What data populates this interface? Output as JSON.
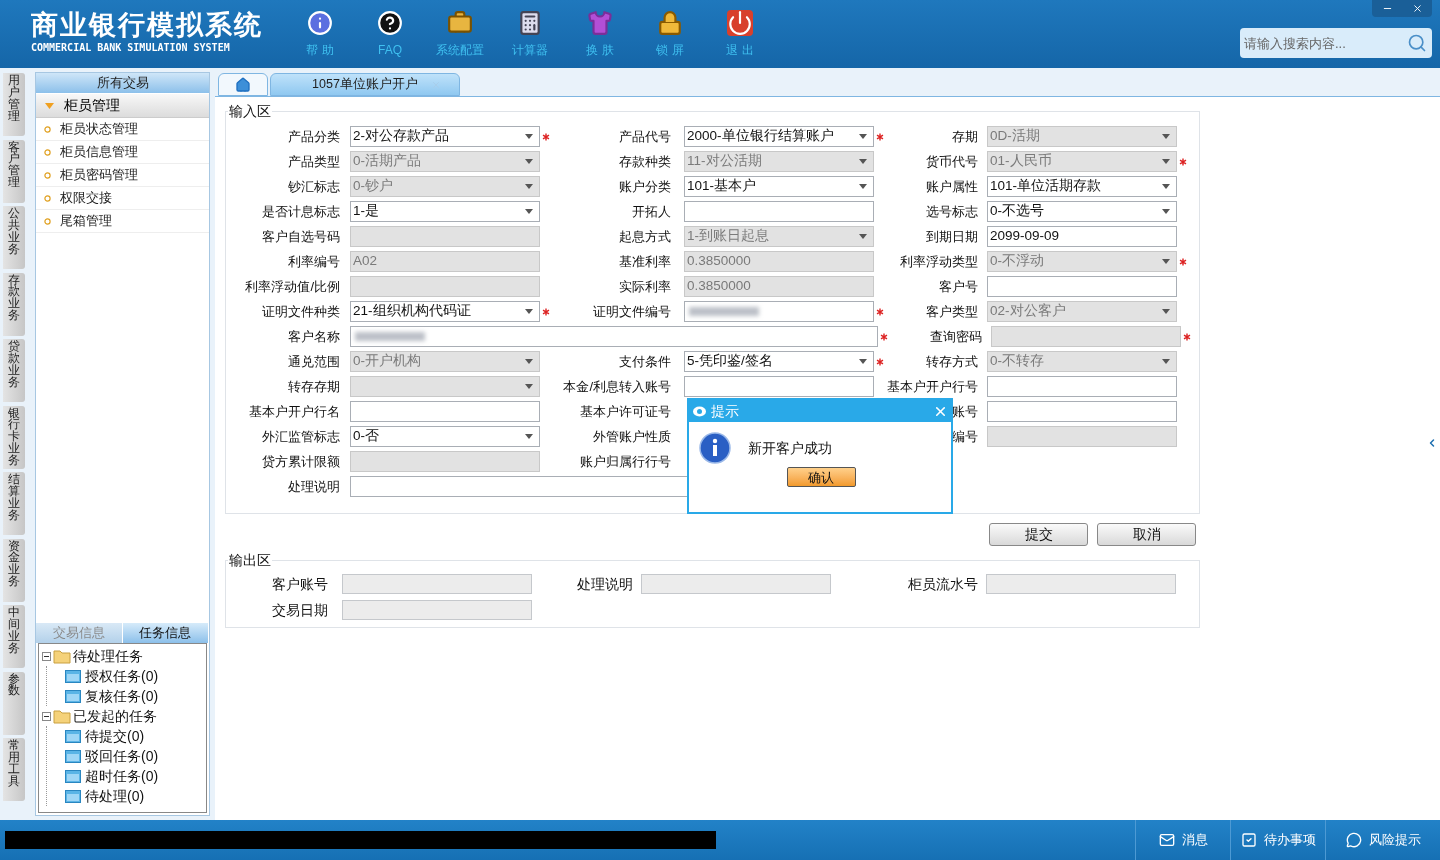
{
  "app": {
    "title": "商业银行模拟系统",
    "subtitle": "COMMERCIAL BANK SIMULATION SYSTEM"
  },
  "toolbar": [
    "帮 助",
    "FAQ",
    "系统配置",
    "计算器",
    "换 肤",
    "锁 屏",
    "退 出"
  ],
  "search": {
    "placeholder": "请输入搜索内容..."
  },
  "side_tabs": [
    "用户管理",
    "客户管理",
    "公共业务",
    "存款业务",
    "贷款业务",
    "银行卡业务",
    "结算业务",
    "资金业务",
    "中间业务",
    "参数",
    "常用工具"
  ],
  "menu": {
    "title": "所有交易",
    "group": {
      "label": "柜员管理",
      "expanded": true,
      "items": [
        "柜员状态管理",
        "柜员信息管理",
        "柜员密码管理",
        "权限交接",
        "尾箱管理"
      ]
    }
  },
  "info_tabs": [
    {
      "label": "交易信息",
      "selected": false
    },
    {
      "label": "任务信息",
      "selected": true
    }
  ],
  "task_tree": [
    {
      "label": "待处理任务",
      "expanded": true,
      "children": [
        {
          "label": "授权任务(0)"
        },
        {
          "label": "复核任务(0)"
        }
      ]
    },
    {
      "label": "已发起的任务",
      "expanded": true,
      "children": [
        {
          "label": "待提交(0)"
        },
        {
          "label": "驳回任务(0)"
        },
        {
          "label": "超时任务(0)"
        },
        {
          "label": "待处理(0)"
        }
      ]
    }
  ],
  "tabs": [
    {
      "kind": "home",
      "selected": false
    },
    {
      "kind": "page",
      "label": "1057单位账户开户",
      "selected": true
    }
  ],
  "input_area": {
    "title": "输入区",
    "rows": [
      [
        {
          "label": "产品分类",
          "kind": "select",
          "value": "2-对公存款产品",
          "disabled": false,
          "required": true
        },
        {
          "label": "产品代号",
          "kind": "select",
          "value": "2000-单位银行结算账户",
          "disabled": false,
          "required": true
        },
        {
          "label": "存期",
          "kind": "select",
          "value": "0D-活期",
          "disabled": true,
          "required": false
        }
      ],
      [
        {
          "label": "产品类型",
          "kind": "select",
          "value": "0-活期产品",
          "disabled": true,
          "required": false
        },
        {
          "label": "存款种类",
          "kind": "select",
          "value": "11-对公活期",
          "disabled": true,
          "required": false
        },
        {
          "label": "货币代号",
          "kind": "select",
          "value": "01-人民币",
          "disabled": true,
          "required": true
        }
      ],
      [
        {
          "label": "钞汇标志",
          "kind": "select",
          "value": "0-钞户",
          "disabled": true,
          "required": false
        },
        {
          "label": "账户分类",
          "kind": "select",
          "value": "101-基本户",
          "disabled": false,
          "required": false
        },
        {
          "label": "账户属性",
          "kind": "select",
          "value": "101-单位活期存款",
          "disabled": false,
          "required": false
        }
      ],
      [
        {
          "label": "是否计息标志",
          "kind": "select",
          "value": "1-是",
          "disabled": false,
          "required": false
        },
        {
          "label": "开拓人",
          "kind": "text",
          "disabled": false,
          "required": false
        },
        {
          "label": "选号标志",
          "kind": "select",
          "value": "0-不选号",
          "disabled": false,
          "required": false
        }
      ],
      [
        {
          "label": "客户自选号码",
          "kind": "text",
          "disabled": true,
          "required": false
        },
        {
          "label": "起息方式",
          "kind": "select",
          "value": "1-到账日起息",
          "disabled": true,
          "required": false
        },
        {
          "label": "到期日期",
          "kind": "text",
          "value": "2099-09-09",
          "disabled": false,
          "required": false
        }
      ],
      [
        {
          "label": "利率编号",
          "kind": "text",
          "value": "A02",
          "disabled": true,
          "required": false
        },
        {
          "label": "基准利率",
          "kind": "text",
          "value": "0.3850000",
          "disabled": true,
          "required": false
        },
        {
          "label": "利率浮动类型",
          "kind": "select",
          "value": "0-不浮动",
          "disabled": true,
          "required": true
        }
      ],
      [
        {
          "label": "利率浮动值/比例",
          "kind": "text",
          "disabled": true,
          "required": false
        },
        {
          "label": "实际利率",
          "kind": "text",
          "value": "0.3850000",
          "disabled": true,
          "required": false
        },
        {
          "label": "客户号",
          "kind": "text",
          "disabled": false,
          "required": false
        }
      ],
      [
        {
          "label": "证明文件种类",
          "kind": "select",
          "value": "21-组织机构代码证",
          "disabled": false,
          "required": true
        },
        {
          "label": "证明文件编号",
          "kind": "text",
          "redacted": true,
          "disabled": false,
          "required": true
        },
        {
          "label": "客户类型",
          "kind": "select",
          "value": "02-对公客户",
          "disabled": true,
          "required": false
        }
      ],
      [
        {
          "label": "客户名称",
          "kind": "wide",
          "redacted": true,
          "disabled": false,
          "required": true
        },
        "",
        {
          "label": "查询密码",
          "kind": "text",
          "disabled": true,
          "required": true
        }
      ],
      [
        {
          "label": "通兑范围",
          "kind": "select",
          "value": "0-开户机构",
          "disabled": true,
          "required": false
        },
        {
          "label": "支付条件",
          "kind": "select",
          "value": "5-凭印鉴/签名",
          "disabled": false,
          "required": true
        },
        {
          "label": "转存方式",
          "kind": "select",
          "value": "0-不转存",
          "disabled": true,
          "required": false
        }
      ],
      [
        {
          "label": "转存存期",
          "kind": "select",
          "disabled": true,
          "required": false
        },
        {
          "label": "本金/利息转入账号",
          "kind": "text",
          "disabled": false,
          "required": false
        },
        {
          "label": "基本户开户行号",
          "kind": "text",
          "disabled": false,
          "required": false
        }
      ],
      [
        {
          "label": "基本户开户行名",
          "kind": "text",
          "disabled": false,
          "required": false
        },
        {
          "label": "基本户许可证号",
          "kind": "covered"
        },
        {
          "label": "账号",
          "kind": "text",
          "disabled": false,
          "required": false
        }
      ],
      [
        {
          "label": "外汇监管标志",
          "kind": "select",
          "value": "0-否",
          "disabled": false,
          "required": false
        },
        {
          "label": "外管账户性质",
          "kind": "covered"
        },
        {
          "label": "编号",
          "kind": "text",
          "disabled": true,
          "required": false
        }
      ],
      [
        {
          "label": "贷方累计限额",
          "kind": "text",
          "disabled": true,
          "required": false
        },
        {
          "label": "账户归属行行号",
          "kind": "covered"
        }
      ],
      [
        {
          "label": "处理说明",
          "kind": "wide",
          "disabled": false
        }
      ]
    ]
  },
  "buttons": [
    "提交",
    "取消"
  ],
  "output_area": {
    "title": "输出区",
    "rows": [
      [
        {
          "label": "客户账号"
        },
        {
          "label": "处理说明"
        },
        {
          "label": "柜员流水号"
        }
      ],
      [
        {
          "label": "交易日期"
        }
      ]
    ]
  },
  "dialog": {
    "title": "提示",
    "message": "新开客户成功",
    "button": "确认"
  },
  "status_bar": [
    "消息",
    "待办事项",
    "风险提示"
  ]
}
